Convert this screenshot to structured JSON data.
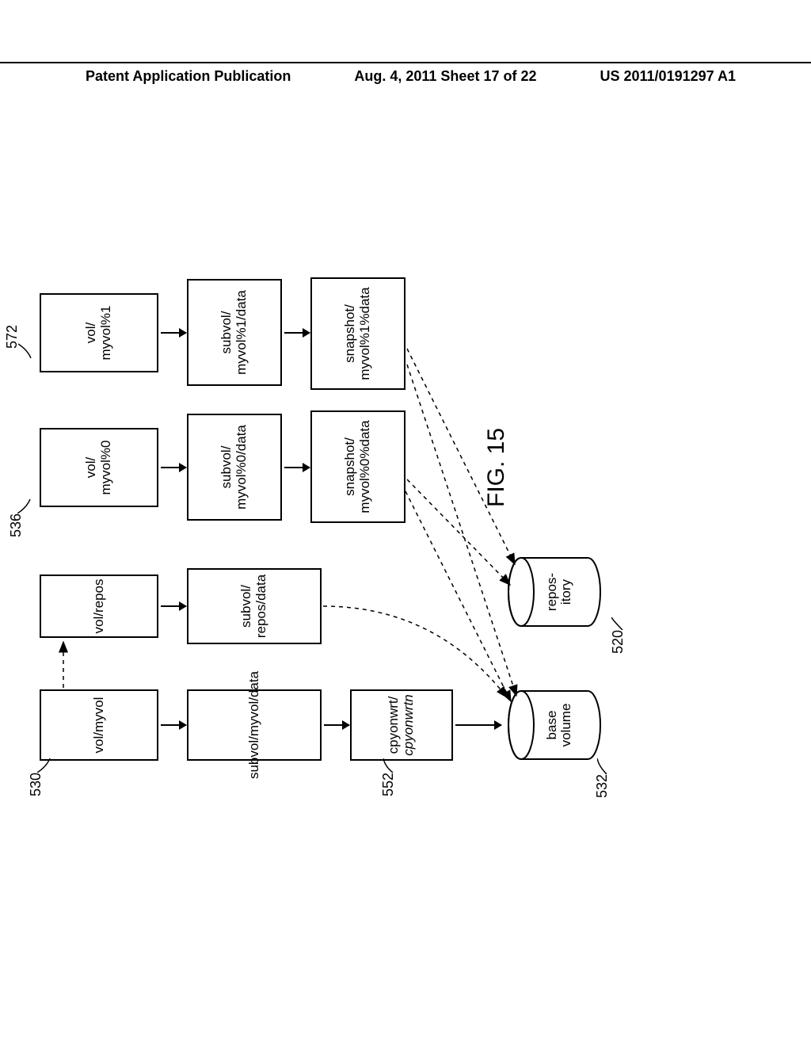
{
  "header": {
    "left": "Patent Application Publication",
    "center": "Aug. 4, 2011  Sheet 17 of 22",
    "right": "US 2011/0191297 A1"
  },
  "figure_label": "FIG. 15",
  "refs": {
    "r530": "530",
    "r552": "552",
    "r520": "520",
    "r532": "532",
    "r536": "536",
    "r572": "572"
  },
  "boxes": {
    "c1r1": "vol/myvol",
    "c1r2": "subvol/myvol/data",
    "c1r3a": "cpyonwrt/",
    "c1r3b": "cpyonwrtn",
    "c2r1": "vol/repos",
    "c2r2": "subvol/\nrepos/data",
    "c3r1a": "vol/",
    "c3r1b": "myvol%0",
    "c3r2a": "subvol/",
    "c3r2b": "myvol%0/data",
    "c3r3a": "snapshot/",
    "c3r3b": "myvol%0%data",
    "c4r1a": "vol/",
    "c4r1b": "myvol%1",
    "c4r2a": "subvol/",
    "c4r2b": "myvol%1/data",
    "c4r3a": "snapshot/",
    "c4r3b": "myvol%1%data"
  },
  "cylinders": {
    "base1": "base",
    "base2": "volume",
    "repos1": "repos-",
    "repos2": "itory"
  }
}
